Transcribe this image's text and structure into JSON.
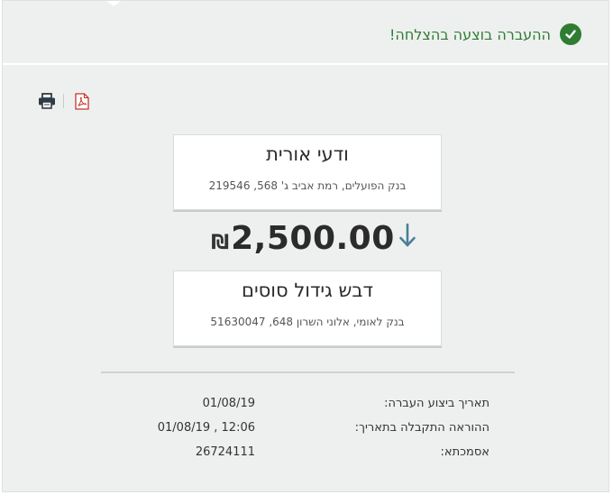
{
  "header": {
    "success_message": "ההעברה בוצעה בהצלחה!",
    "icon": "check-circle-icon",
    "accent_color": "#2e7d32"
  },
  "actions": {
    "print_icon": "printer-icon",
    "pdf_icon": "pdf-icon"
  },
  "transfer": {
    "from": {
      "name": "ודעי אורית",
      "details": "בנק הפועלים, רמת אביב ג' 568, 219546"
    },
    "amount": "2,500.00",
    "currency": "₪",
    "direction_icon": "arrow-down-icon",
    "to": {
      "name": "דבש גידול סוסים",
      "details": "בנק לאומי, אלוני השרון 648, 51630047"
    }
  },
  "details": [
    {
      "label": "תאריך ביצוע העברה:",
      "value": "01/08/19"
    },
    {
      "label": "ההוראה התקבלה בתאריך:",
      "value": "01/08/19 , 12:06"
    },
    {
      "label": "אסמכתא:",
      "value": "26724111"
    }
  ]
}
